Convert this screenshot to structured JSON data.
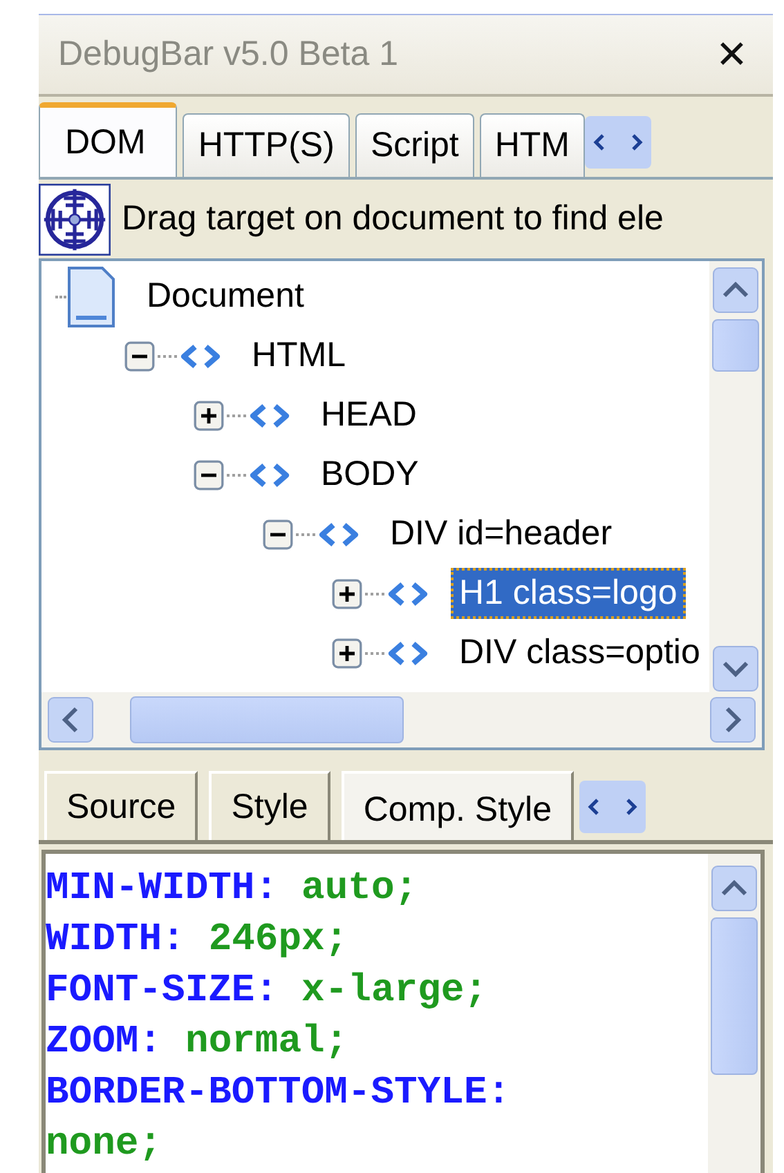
{
  "window": {
    "title": "DebugBar v5.0 Beta 1",
    "close": "✕"
  },
  "tabs": [
    {
      "label": "DOM",
      "selected": true
    },
    {
      "label": "HTTP(S)",
      "selected": false
    },
    {
      "label": "Script",
      "selected": false
    },
    {
      "label": "HTM",
      "selected": false
    }
  ],
  "finder": {
    "text": "Drag target on document to find ele"
  },
  "tree": [
    {
      "label": "Document",
      "kind": "document",
      "selected": false,
      "children": [
        {
          "label": "HTML",
          "kind": "element",
          "expanded": true,
          "selected": false,
          "children": [
            {
              "label": "HEAD",
              "kind": "element",
              "expanded": false,
              "selected": false
            },
            {
              "label": "BODY",
              "kind": "element",
              "expanded": true,
              "selected": false,
              "children": [
                {
                  "label": "DIV id=header",
                  "kind": "element",
                  "expanded": true,
                  "selected": false,
                  "children": [
                    {
                      "label": "H1 class=logo",
                      "kind": "element",
                      "expanded": false,
                      "selected": true
                    },
                    {
                      "label": "DIV class=optio",
                      "kind": "element",
                      "expanded": false,
                      "selected": false
                    }
                  ]
                }
              ]
            }
          ]
        }
      ]
    }
  ],
  "detail_tabs": [
    {
      "label": "Source",
      "selected": false
    },
    {
      "label": "Style",
      "selected": false
    },
    {
      "label": "Comp. Style",
      "selected": true
    }
  ],
  "styles": [
    {
      "property": "MIN-WIDTH:",
      "value": "auto;"
    },
    {
      "property": "WIDTH:",
      "value": "246px;"
    },
    {
      "property": "FONT-SIZE:",
      "value": "x-large;"
    },
    {
      "property": "ZOOM:",
      "value": "normal;"
    },
    {
      "property": "BORDER-BOTTOM-STYLE:"
    },
    {
      "value": "none;"
    }
  ]
}
